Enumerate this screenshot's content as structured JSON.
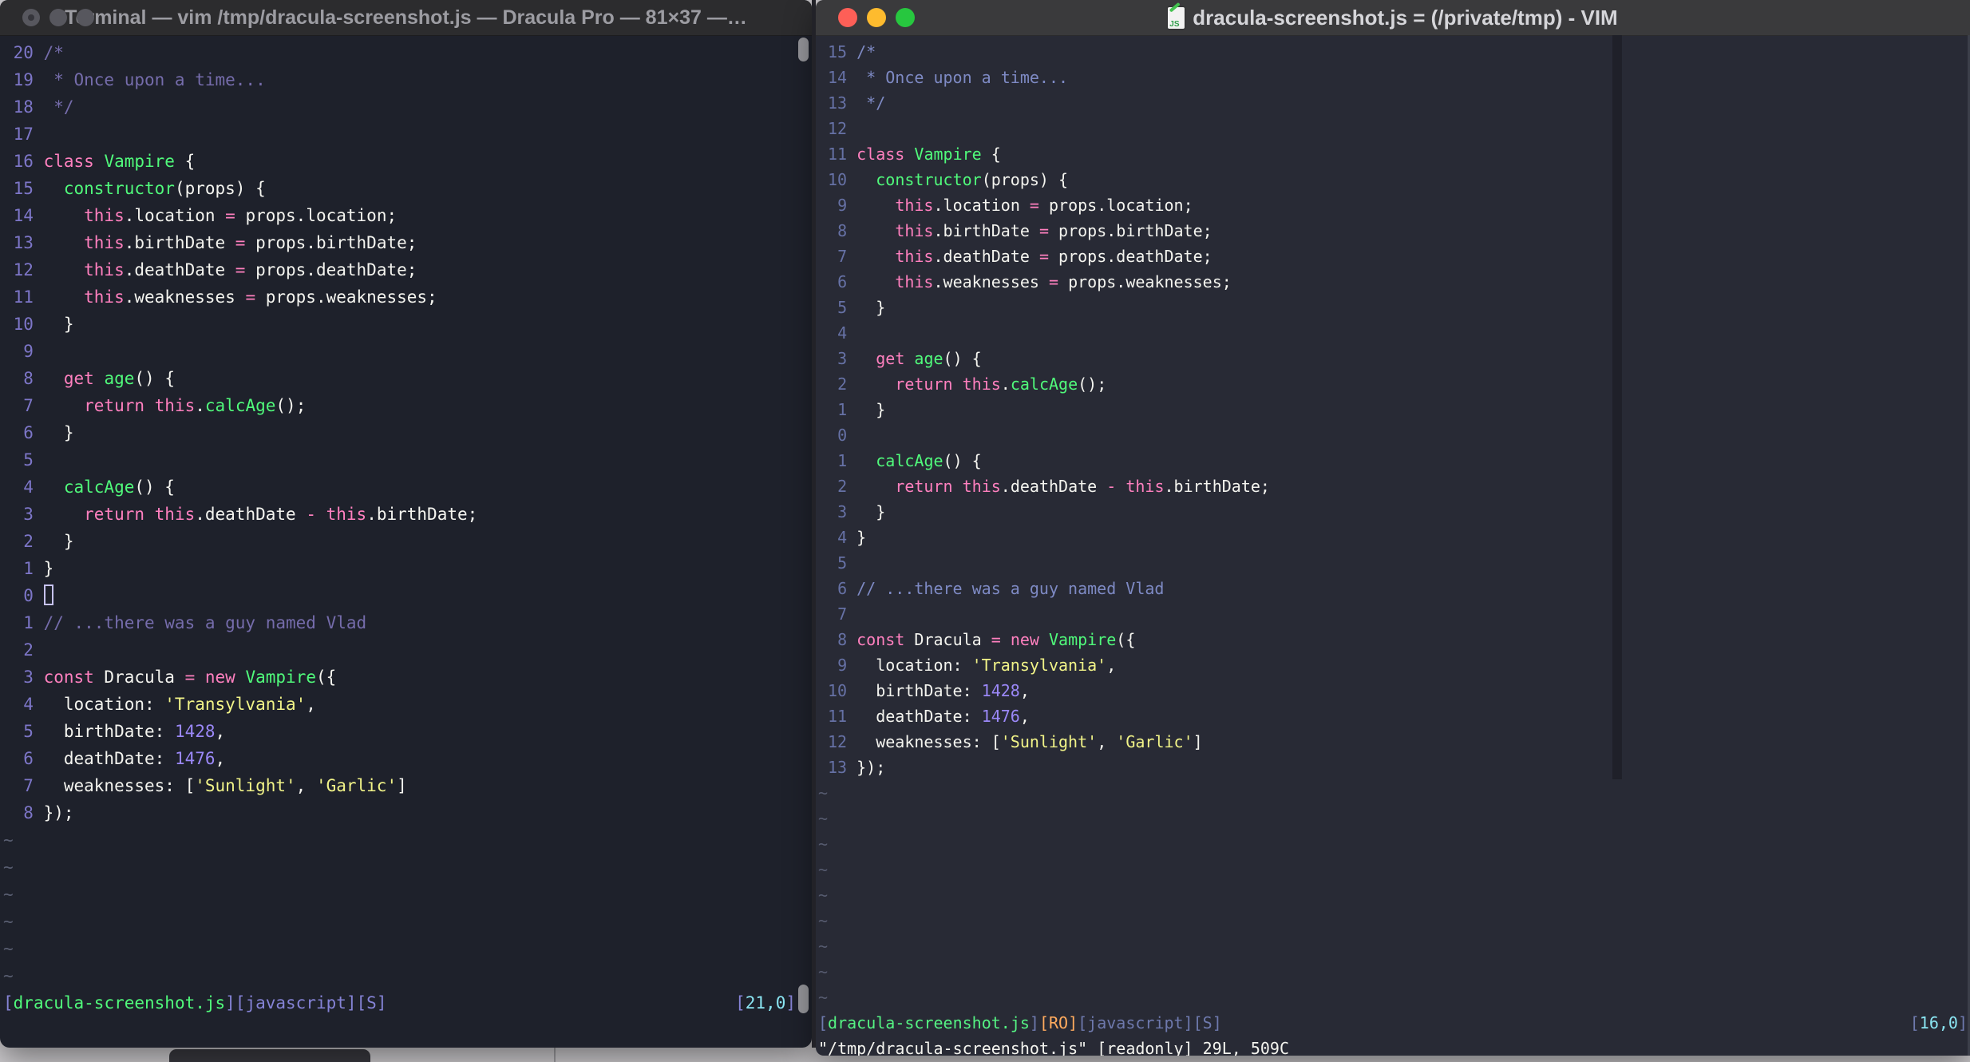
{
  "code_lines": [
    [
      [
        "c",
        "/*"
      ]
    ],
    [
      [
        "c",
        " * Once upon a time..."
      ]
    ],
    [
      [
        "c",
        " */"
      ]
    ],
    [],
    [
      [
        "p",
        "class"
      ],
      [
        "f",
        " "
      ],
      [
        "g",
        "Vampire"
      ],
      [
        "f",
        " {"
      ]
    ],
    [
      [
        "f",
        "  "
      ],
      [
        "g",
        "constructor"
      ],
      [
        "f",
        "(props) {"
      ]
    ],
    [
      [
        "f",
        "    "
      ],
      [
        "p",
        "this"
      ],
      [
        "f",
        ".location "
      ],
      [
        "p",
        "="
      ],
      [
        "f",
        " props.location;"
      ]
    ],
    [
      [
        "f",
        "    "
      ],
      [
        "p",
        "this"
      ],
      [
        "f",
        ".birthDate "
      ],
      [
        "p",
        "="
      ],
      [
        "f",
        " props.birthDate;"
      ]
    ],
    [
      [
        "f",
        "    "
      ],
      [
        "p",
        "this"
      ],
      [
        "f",
        ".deathDate "
      ],
      [
        "p",
        "="
      ],
      [
        "f",
        " props.deathDate;"
      ]
    ],
    [
      [
        "f",
        "    "
      ],
      [
        "p",
        "this"
      ],
      [
        "f",
        ".weaknesses "
      ],
      [
        "p",
        "="
      ],
      [
        "f",
        " props.weaknesses;"
      ]
    ],
    [
      [
        "f",
        "  }"
      ]
    ],
    [],
    [
      [
        "f",
        "  "
      ],
      [
        "p",
        "get"
      ],
      [
        "f",
        " "
      ],
      [
        "g",
        "age"
      ],
      [
        "f",
        "() {"
      ]
    ],
    [
      [
        "f",
        "    "
      ],
      [
        "p",
        "return"
      ],
      [
        "f",
        " "
      ],
      [
        "p",
        "this"
      ],
      [
        "f",
        "."
      ],
      [
        "g",
        "calcAge"
      ],
      [
        "f",
        "();"
      ]
    ],
    [
      [
        "f",
        "  }"
      ]
    ],
    [],
    [
      [
        "f",
        "  "
      ],
      [
        "g",
        "calcAge"
      ],
      [
        "f",
        "() {"
      ]
    ],
    [
      [
        "f",
        "    "
      ],
      [
        "p",
        "return"
      ],
      [
        "f",
        " "
      ],
      [
        "p",
        "this"
      ],
      [
        "f",
        ".deathDate "
      ],
      [
        "p",
        "-"
      ],
      [
        "f",
        " "
      ],
      [
        "p",
        "this"
      ],
      [
        "f",
        ".birthDate;"
      ]
    ],
    [
      [
        "f",
        "  }"
      ]
    ],
    [
      [
        "f",
        "}"
      ]
    ],
    [],
    [
      [
        "c",
        "// ...there was a guy named Vlad"
      ]
    ],
    [],
    [
      [
        "p",
        "const"
      ],
      [
        "f",
        " Dracula "
      ],
      [
        "p",
        "="
      ],
      [
        "f",
        " "
      ],
      [
        "p",
        "new"
      ],
      [
        "f",
        " "
      ],
      [
        "g",
        "Vampire"
      ],
      [
        "f",
        "({"
      ]
    ],
    [
      [
        "f",
        "  location: "
      ],
      [
        "y",
        "'Transylvania'"
      ],
      [
        "f",
        ","
      ]
    ],
    [
      [
        "f",
        "  birthDate: "
      ],
      [
        "n",
        "1428"
      ],
      [
        "f",
        ","
      ]
    ],
    [
      [
        "f",
        "  deathDate: "
      ],
      [
        "n",
        "1476"
      ],
      [
        "f",
        ","
      ]
    ],
    [
      [
        "f",
        "  weaknesses: ["
      ],
      [
        "y",
        "'Sunlight'"
      ],
      [
        "f",
        ", "
      ],
      [
        "y",
        "'Garlic'"
      ],
      [
        "f",
        "]"
      ]
    ],
    [
      [
        "f",
        "});"
      ]
    ]
  ],
  "windows": {
    "left": {
      "title": "Terminal — vim /tmp/dracula-screenshot.js — Dracula Pro — 81×37 —…",
      "cursor_line": 21,
      "cursor_style": "hollow",
      "tildes": 6,
      "cmdline": "",
      "traffic": [
        "#57575e",
        "#57575e",
        "#57575e"
      ],
      "palette": {
        "bg": "#1e212b",
        "f": "#f4f4ef",
        "c": "#756cab",
        "p": "#ff80bf",
        "g": "#50fa7b",
        "y": "#f1f388",
        "n": "#9b88f8",
        "num": "#7d76c8",
        "tilde": "#595e71",
        "sb": "#8583d6",
        "sf": "#50fa7b",
        "sp": "#8ae5f2",
        "so": "#ffb86c",
        "cursor": "#c7c3f4"
      },
      "status_left": [
        [
          "sb",
          "["
        ],
        [
          "sf",
          "dracula-screenshot.js"
        ],
        [
          "sb",
          "][javascript][S]"
        ]
      ],
      "status_right": [
        [
          "sb",
          "["
        ],
        [
          "sp",
          "21,0"
        ],
        [
          "sb",
          "]"
        ]
      ]
    },
    "right": {
      "title": "dracula-screenshot.js = (/private/tmp) - VIM",
      "cursor_line": 16,
      "cursor_style": "none",
      "tildes": 9,
      "cmdline": "\"/tmp/dracula-screenshot.js\" [readonly] 29L, 509C",
      "traffic": [
        "#fe5f57",
        "#febb2e",
        "#27c73f"
      ],
      "palette": {
        "bg": "#282a35",
        "f": "#f4f4ef",
        "c": "#7e8ac4",
        "p": "#ff80bf",
        "g": "#50fa7b",
        "y": "#f1f388",
        "n": "#9b88f8",
        "num": "#6671a5",
        "tilde": "#565b6f",
        "sb": "#6e79ad",
        "sf": "#55f383",
        "sp": "#8ae5f2",
        "so": "#ffab5e",
        "cursor": "#c7c3f4"
      },
      "status_left": [
        [
          "sb",
          "["
        ],
        [
          "sf",
          "dracula-screenshot.js"
        ],
        [
          "sb",
          "]"
        ],
        [
          "so",
          "[RO]"
        ],
        [
          "sb",
          "[javascript][S]"
        ]
      ],
      "status_right": [
        [
          "sb",
          "["
        ],
        [
          "sp",
          "16,0"
        ],
        [
          "sb",
          "]"
        ]
      ]
    }
  },
  "icons": {
    "proxy_js_label": "JS"
  },
  "desktop": {
    "strip_color": "#d0ced1",
    "blob_color": "#3a3a40"
  }
}
